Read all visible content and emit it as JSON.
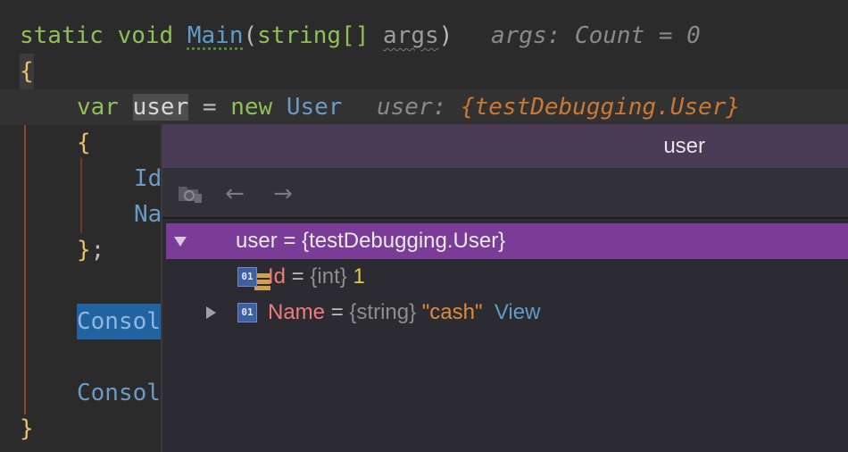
{
  "editor": {
    "line1": {
      "static": "static",
      "void": "void",
      "method": "Main",
      "open_paren": "(",
      "param_type": "string[]",
      "param_name": "args",
      "close_paren": ")",
      "hint": "args: Count = 0"
    },
    "line2": {
      "brace": "{"
    },
    "line3": {
      "var": "var",
      "name": "user",
      "eq": "=",
      "new": "new",
      "type": "User",
      "hint_label": "user:",
      "hint_value": "{testDebugging.User}"
    },
    "line4": {
      "brace": "{"
    },
    "line5": {
      "text": "Id"
    },
    "line6": {
      "text": "Na"
    },
    "line7": {
      "brace": "}",
      "semi": ";"
    },
    "line8": {
      "text": "Consol"
    },
    "line9": {
      "text": "Consol"
    },
    "line10": {
      "brace": "}"
    }
  },
  "popup": {
    "title": "user",
    "toolbar": {
      "icons": [
        "show-in-tree-icon",
        "back-arrow-icon",
        "forward-arrow-icon"
      ],
      "back": "←",
      "forward": "→"
    },
    "tree": {
      "root": {
        "name": "user",
        "eq": " = ",
        "value": "{testDebugging.User}",
        "expanded": true
      },
      "fields": [
        {
          "icon": "01",
          "name": "Id",
          "eq": " = ",
          "type": "{int}",
          "value": "1",
          "expandable": false
        },
        {
          "icon": "01",
          "name": "Name",
          "eq": " = ",
          "type": "{string}",
          "value": "\"cash\"",
          "link": "View",
          "expandable": true
        }
      ]
    }
  },
  "colors": {
    "editor_bg": "#2b2b2b",
    "popup_header": "#4a3b57",
    "selected_row": "#7a3c96",
    "keyword": "#8fbf57",
    "hint_value": "#cc7832"
  }
}
